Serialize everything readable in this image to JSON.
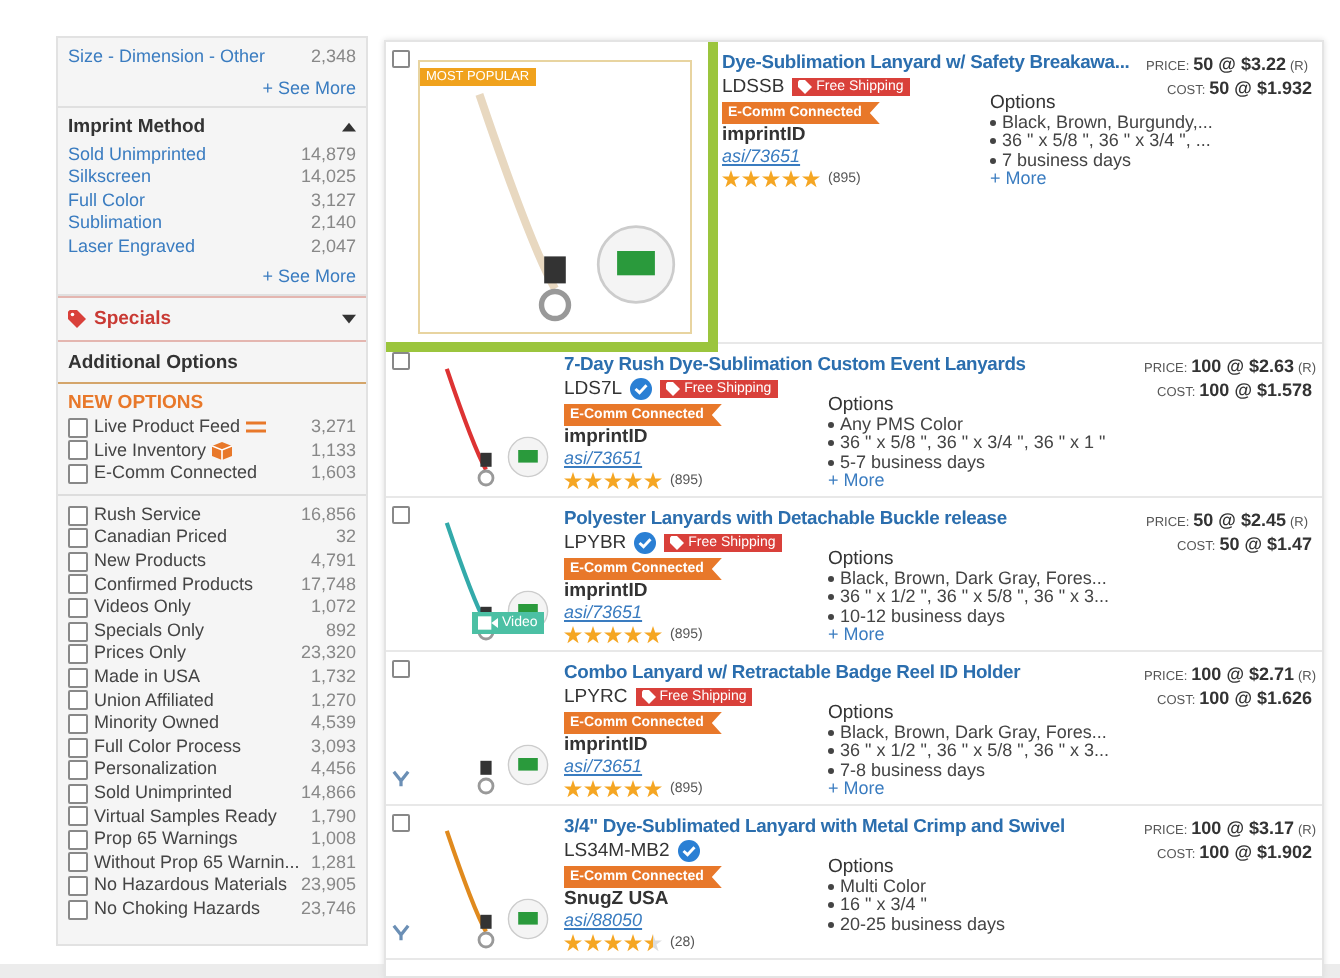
{
  "sidebar": {
    "size_section": {
      "items": [
        {
          "label": "Size - Dimension - Other",
          "count": "2,348"
        }
      ],
      "see_more": "+ See More"
    },
    "imprint_method": {
      "title": "Imprint Method",
      "expanded": true,
      "items": [
        {
          "label": "Sold Unimprinted",
          "count": "14,879"
        },
        {
          "label": "Silkscreen",
          "count": "14,025"
        },
        {
          "label": "Full Color",
          "count": "3,127"
        },
        {
          "label": "Sublimation",
          "count": "2,140"
        },
        {
          "label": "Laser Engraved",
          "count": "2,047"
        }
      ],
      "see_more": "+ See More"
    },
    "specials": {
      "title": "Specials",
      "expanded": false
    },
    "additional_options": {
      "title": "Additional Options",
      "new_options_title": "NEW OPTIONS",
      "new_options": [
        {
          "label": "Live Product Feed",
          "count": "3,271",
          "checked": false,
          "kind": "feed"
        },
        {
          "label": "Live Inventory",
          "count": "1,133",
          "checked": false,
          "kind": "inventory"
        },
        {
          "label": "E-Comm Connected",
          "count": "1,603",
          "checked": false,
          "kind": "plain"
        }
      ],
      "items": [
        {
          "label": "Rush Service",
          "count": "16,856",
          "checked": false
        },
        {
          "label": "Canadian Priced",
          "count": "32",
          "checked": false
        },
        {
          "label": "New Products",
          "count": "4,791",
          "checked": false
        },
        {
          "label": "Confirmed Products",
          "count": "17,748",
          "checked": false
        },
        {
          "label": "Videos Only",
          "count": "1,072",
          "checked": false
        },
        {
          "label": "Specials Only",
          "count": "892",
          "checked": false
        },
        {
          "label": "Prices Only",
          "count": "23,320",
          "checked": false
        },
        {
          "label": "Made in USA",
          "count": "1,732",
          "checked": false
        },
        {
          "label": "Union Affiliated",
          "count": "1,270",
          "checked": false
        },
        {
          "label": "Minority Owned",
          "count": "4,539",
          "checked": false
        },
        {
          "label": "Full Color Process",
          "count": "3,093",
          "checked": false
        },
        {
          "label": "Personalization",
          "count": "4,456",
          "checked": false
        },
        {
          "label": "Sold Unimprinted",
          "count": "14,866",
          "checked": false
        },
        {
          "label": "Virtual Samples Ready",
          "count": "1,790",
          "checked": false
        },
        {
          "label": "Prop 65 Warnings",
          "count": "1,008",
          "checked": false
        },
        {
          "label": "Without Prop 65 Warnin...",
          "count": "1,281",
          "checked": false
        },
        {
          "label": "No Hazardous Materials",
          "count": "23,905",
          "checked": false
        },
        {
          "label": "No Choking Hazards",
          "count": "23,746",
          "checked": false
        }
      ]
    }
  },
  "products": [
    {
      "selected": false,
      "highlighted": true,
      "badge": "MOST POPULAR",
      "title": "Dye-Sublimation Lanyard w/ Safety Breakawa...",
      "code": "LDSSB",
      "verified": false,
      "free_shipping": "Free Shipping",
      "ecomm": "E-Comm Connected",
      "supplier": "imprintID",
      "asi": "asi/73651",
      "stars": 5,
      "reviews": "(895)",
      "options_title": "Options",
      "options": [
        "Black, Brown, Burgundy,...",
        "36 \" x 5/8 \", 36 \" x 3/4 \", ...",
        "7 business days"
      ],
      "more": "+ More",
      "price": {
        "label": "PRICE:",
        "value": "50 @ $3.22",
        "note": "(R)"
      },
      "cost": {
        "label": "COST:",
        "value": "50 @ $1.932"
      },
      "lanyard_icon": false
    },
    {
      "selected": false,
      "highlighted": false,
      "title": "7-Day Rush Dye-Sublimation Custom Event Lanyards",
      "code": "LDS7L",
      "verified": true,
      "free_shipping": "Free Shipping",
      "ecomm": "E-Comm Connected",
      "supplier": "imprintID",
      "asi": "asi/73651",
      "stars": 5,
      "reviews": "(895)",
      "options_title": "Options",
      "options": [
        "Any PMS Color",
        "36 \" x 5/8 \", 36 \" x 3/4 \", 36 \" x 1 \"",
        "5-7 business days"
      ],
      "more": "+ More",
      "price": {
        "label": "PRICE:",
        "value": "100 @ $2.63",
        "note": "(R)"
      },
      "cost": {
        "label": "COST:",
        "value": "100 @ $1.578"
      },
      "lanyard_icon": false
    },
    {
      "selected": false,
      "highlighted": false,
      "video": "Video",
      "title": "Polyester Lanyards with Detachable Buckle release",
      "code": "LPYBR",
      "verified": true,
      "free_shipping": "Free Shipping",
      "ecomm": "E-Comm Connected",
      "supplier": "imprintID",
      "asi": "asi/73651",
      "stars": 5,
      "reviews": "(895)",
      "options_title": "Options",
      "options": [
        "Black, Brown, Dark Gray, Fores...",
        "36 \" x 1/2 \", 36 \" x 5/8 \", 36 \" x 3...",
        "10-12 business days"
      ],
      "more": "+ More",
      "price": {
        "label": "PRICE:",
        "value": "50 @ $2.45",
        "note": "(R)"
      },
      "cost": {
        "label": "COST:",
        "value": "50 @ $1.47"
      },
      "lanyard_icon": false
    },
    {
      "selected": false,
      "highlighted": false,
      "title": "Combo Lanyard w/ Retractable Badge Reel ID Holder",
      "code": "LPYRC",
      "verified": false,
      "free_shipping": "Free Shipping",
      "ecomm": "E-Comm Connected",
      "supplier": "imprintID",
      "asi": "asi/73651",
      "stars": 5,
      "reviews": "(895)",
      "options_title": "Options",
      "options": [
        "Black, Brown, Dark Gray, Fores...",
        "36 \" x 1/2 \", 36 \" x 5/8 \", 36 \" x 3...",
        "7-8 business days"
      ],
      "more": "+ More",
      "price": {
        "label": "PRICE:",
        "value": "100 @ $2.71",
        "note": "(R)"
      },
      "cost": {
        "label": "COST:",
        "value": "100 @ $1.626"
      },
      "lanyard_icon": true
    },
    {
      "selected": false,
      "highlighted": false,
      "title": "3/4\" Dye-Sublimated Lanyard with Metal Crimp and Swivel",
      "code": "LS34M-MB2",
      "verified": true,
      "ecomm": "E-Comm Connected",
      "supplier": "SnugZ USA",
      "asi": "asi/88050",
      "stars": 4.5,
      "reviews": "(28)",
      "options_title": "Options",
      "options": [
        "Multi Color",
        "16 \" x 3/4 \"",
        "20-25 business days"
      ],
      "price": {
        "label": "PRICE:",
        "value": "100 @ $3.17",
        "note": "(R)"
      },
      "cost": {
        "label": "COST:",
        "value": "100 @ $1.902"
      },
      "lanyard_icon": true
    }
  ]
}
